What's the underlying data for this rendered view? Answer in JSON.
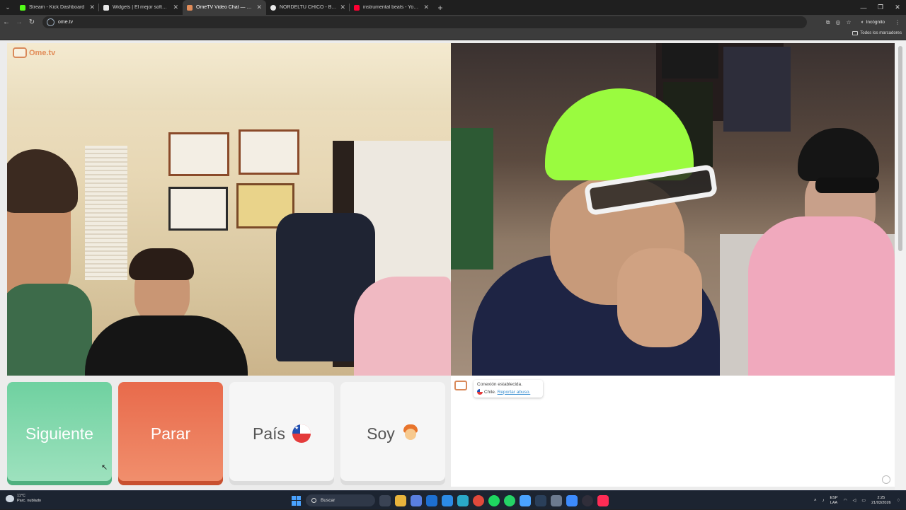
{
  "browser": {
    "tabs": [
      {
        "title": "Stream - Kick Dashboard",
        "favicon_color": "#53fc18",
        "active": false
      },
      {
        "title": "Widgets | El mejor software pa",
        "favicon_color": "#e8e8e8",
        "active": false
      },
      {
        "title": "OmeTV Video Chat — Ome",
        "favicon_color": "#e28c59",
        "active": true
      },
      {
        "title": "NORDELTU CHICO - Buscar con",
        "favicon_color": "#e8e8e8",
        "active": false
      },
      {
        "title": "instrumental beats - YouTube",
        "favicon_color": "#ff0033",
        "active": false
      }
    ],
    "url": "ome.tv",
    "incognito_label": "Incógnito",
    "bookmarks_all_label": "Todos los marcadores"
  },
  "ome": {
    "logo_text": "Ome.tv",
    "buttons": {
      "next_label": "Siguiente",
      "stop_label": "Parar",
      "country_label": "País",
      "gender_label": "Soy"
    },
    "chat": {
      "status": "Conexión establecida.",
      "country": "Chile.",
      "report_link": "Reportar abuso."
    }
  },
  "taskbar": {
    "weather_temp": "11°C",
    "weather_desc": "Parc. nublado",
    "search_label": "Buscar",
    "lang_top": "ESP",
    "lang_bottom": "LAA",
    "time": "2:25",
    "date": "21/03/2026"
  },
  "colors": {
    "next_green": "#6fd1a0",
    "stop_red": "#e86a4b",
    "brand_orange": "#e28c59"
  }
}
